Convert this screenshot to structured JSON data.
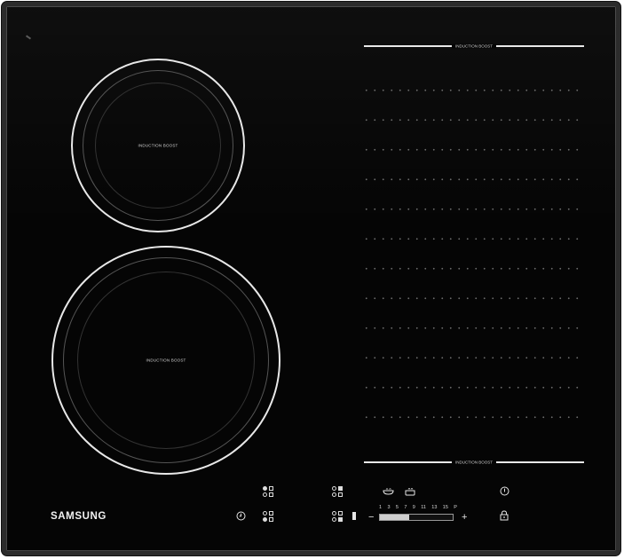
{
  "brand": "SAMSUNG",
  "zones": {
    "top_left_label": "INDUCTION BOOST",
    "bottom_left_label": "INDUCTION BOOST",
    "flex_top_label": "INDUCTION BOOST",
    "flex_bottom_label": "INDUCTION BOOST"
  },
  "controls": {
    "power_scale": [
      "1",
      "3",
      "5",
      "7",
      "9",
      "11",
      "13",
      "15",
      "P"
    ],
    "minus": "−",
    "plus": "+",
    "icons": [
      "timer-icon",
      "zone-select-icon",
      "pan-icon",
      "pot-icon",
      "power-icon",
      "lock-icon"
    ]
  },
  "colors": {
    "glass": "#050505",
    "frame": "#2c2c2c",
    "ring": "#e8e8e8",
    "text": "#e6e6e6"
  }
}
